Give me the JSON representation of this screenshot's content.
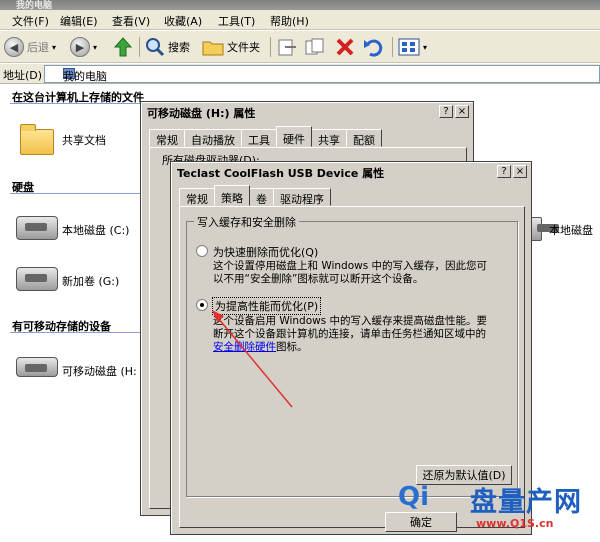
{
  "window": {
    "title": "我的电脑"
  },
  "menu": {
    "items": [
      "文件(F)",
      "编辑(E)",
      "查看(V)",
      "收藏(A)",
      "工具(T)",
      "帮助(H)"
    ]
  },
  "toolbar": {
    "back": "后退",
    "search": "搜索",
    "folders": "文件夹"
  },
  "address": {
    "label": "地址(D)",
    "value": "我的电脑"
  },
  "content": {
    "section_files": "在这台计算机上存储的文件",
    "shared_docs": "共享文档",
    "section_hdd": "硬盘",
    "drive_c": "本地磁盘 (C:)",
    "drive_g": "新加卷 (G:)",
    "drive_right": "本地磁盘",
    "section_removable": "有可移动存储的设备",
    "removable": "可移动磁盘 (H:"
  },
  "props_dialog": {
    "title": "可移动磁盘 (H:) 属性",
    "tabs": [
      "常规",
      "自动播放",
      "工具",
      "硬件",
      "共享",
      "配额"
    ],
    "partial_label": "所有磁盘驱动器(D):"
  },
  "device_dialog": {
    "title": "Teclast CoolFlash USB Device 属性",
    "tabs": [
      "常规",
      "策略",
      "卷",
      "驱动程序"
    ],
    "group_label": "写入缓存和安全删除",
    "opt1_label": "为快速删除而优化(Q)",
    "opt1_desc_1": "这个设置停用磁盘上和 Windows 中的写入缓存，因此您可",
    "opt1_desc_2": "以不用“安全删除”图标就可以断开这个设备。",
    "opt2_label": "为提高性能而优化(P)",
    "opt2_desc_1": "这个设备启用 Windows 中的写入缓存来提高磁盘性能。要",
    "opt2_desc_2": "断开这个设备跟计算机的连接，请单击任务栏通知区域中的",
    "opt2_desc_link": "安全删除硬件",
    "opt2_desc_tail": "图标。",
    "restore_button": "还原为默认值(D)",
    "ok_button": "确定"
  },
  "watermark": {
    "left": "Qi",
    "main": "盘量产网",
    "url": "www.Q1S.cn"
  },
  "colors": {
    "dialog_face": "#d4d0c8",
    "arrow": "#e03030",
    "link": "#0000ee",
    "watermark_blue": "#1f5fbf"
  }
}
